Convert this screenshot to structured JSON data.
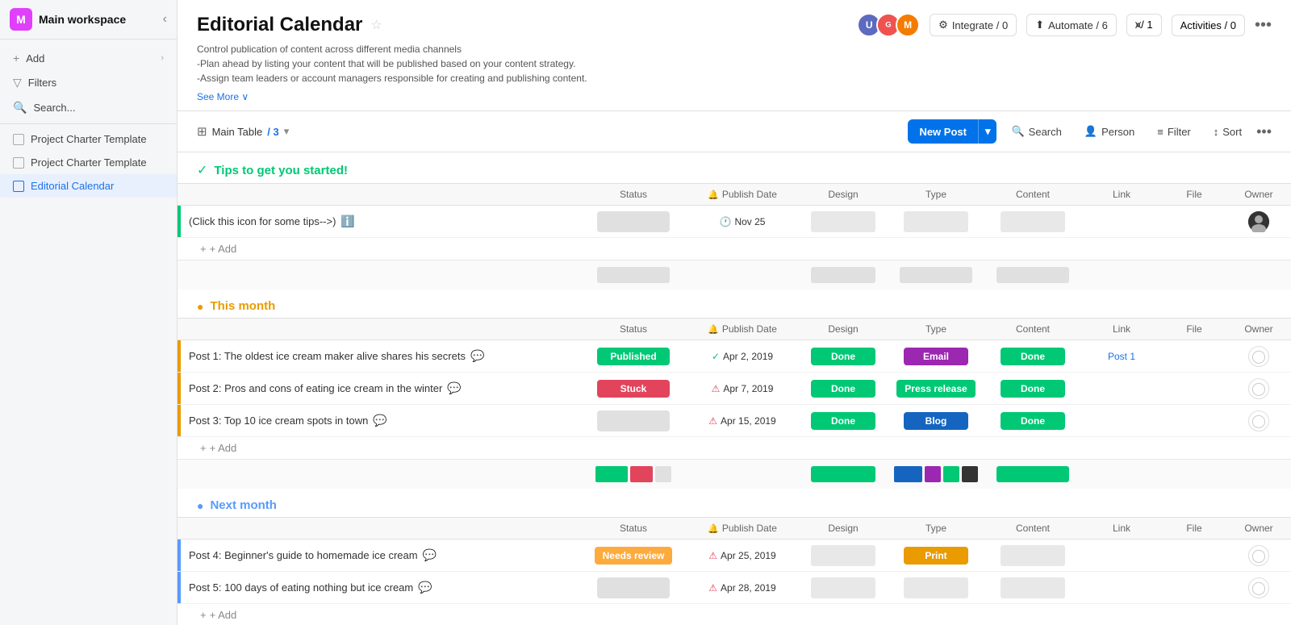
{
  "sidebar": {
    "workspace": "Main workspace",
    "logo_letter": "M",
    "nav_items": [
      {
        "label": "Add",
        "icon": "+",
        "has_arrow": true
      },
      {
        "label": "Filters",
        "icon": "▽",
        "has_arrow": false
      },
      {
        "label": "Search...",
        "icon": "🔍",
        "has_arrow": false
      }
    ],
    "projects": [
      {
        "label": "Project Charter Template",
        "active": false
      },
      {
        "label": "Project Charter Template",
        "active": false
      },
      {
        "label": "Editorial Calendar",
        "active": true
      }
    ]
  },
  "header": {
    "title": "Editorial Calendar",
    "description1": "Control publication of content across different media channels",
    "description2": "-Plan ahead by listing your content that will be published based on your content strategy.",
    "description3": "-Assign team leaders or account managers responsible for creating and publishing content.",
    "see_more": "See More ∨",
    "integrate_label": "Integrate / 0",
    "automate_label": "Automate / 6",
    "members_label": "⩙/ 1",
    "activities_label": "Activities / 0",
    "more_icon": "•••"
  },
  "toolbar": {
    "table_name": "Main Table",
    "table_count": "/ 3",
    "new_post_label": "New Post",
    "search_label": "Search",
    "person_label": "Person",
    "filter_label": "Filter",
    "sort_label": "Sort",
    "more_icon": "•••"
  },
  "columns": {
    "status": "Status",
    "publish_date": "Publish Date",
    "design": "Design",
    "type": "Type",
    "content": "Content",
    "link": "Link",
    "file": "File",
    "owner": "Owner"
  },
  "groups": [
    {
      "id": "tips",
      "title": "Tips to get you started!",
      "color": "green",
      "icon": "✓",
      "rows": [
        {
          "name": "(Click this icon for some tips-->)",
          "has_tip_icon": true,
          "left_bar": "green",
          "status": "",
          "publish_date": "Nov 25",
          "publish_date_icon": "clock",
          "design": "",
          "type": "",
          "content": "",
          "link": "",
          "file": "",
          "owner": "dark"
        }
      ]
    },
    {
      "id": "this_month",
      "title": "This month",
      "color": "orange",
      "icon": "●",
      "rows": [
        {
          "name": "Post 1: The oldest ice cream maker alive shares his secrets",
          "left_bar": "orange",
          "status": "Published",
          "status_class": "status-published",
          "publish_date": "Apr 2, 2019",
          "publish_date_icon": "check",
          "design": "Done",
          "type": "Email",
          "type_class": "type-email",
          "content": "Done",
          "link": "Post 1",
          "has_link": true,
          "file": "",
          "owner": "placeholder"
        },
        {
          "name": "Post 2: Pros and cons of eating ice cream in the winter",
          "left_bar": "orange",
          "status": "Stuck",
          "status_class": "status-stuck",
          "publish_date": "Apr 7, 2019",
          "publish_date_icon": "warning",
          "design": "Done",
          "type": "Press release",
          "type_class": "type-press",
          "content": "Done",
          "link": "",
          "file": "",
          "owner": "placeholder"
        },
        {
          "name": "Post 3: Top 10 ice cream spots in town",
          "left_bar": "orange",
          "status": "",
          "publish_date": "Apr 15, 2019",
          "publish_date_icon": "warning",
          "design": "Done",
          "type": "Blog",
          "type_class": "type-blog",
          "content": "Done",
          "link": "",
          "file": "",
          "owner": "placeholder"
        }
      ]
    },
    {
      "id": "next_month",
      "title": "Next month",
      "color": "blue",
      "icon": "●",
      "rows": [
        {
          "name": "Post 4: Beginner's guide to homemade ice cream",
          "left_bar": "blue",
          "status": "Needs review",
          "status_class": "status-needs-review",
          "publish_date": "Apr 25, 2019",
          "publish_date_icon": "warning",
          "design": "",
          "type": "Print",
          "type_class": "type-print",
          "content": "",
          "link": "",
          "file": "",
          "owner": "placeholder"
        },
        {
          "name": "Post 5: 100 days of eating nothing but ice cream",
          "left_bar": "blue",
          "status": "",
          "publish_date": "Apr 28, 2019",
          "publish_date_icon": "warning",
          "design": "",
          "type": "",
          "content": "",
          "link": "",
          "file": "",
          "owner": "placeholder"
        }
      ]
    }
  ]
}
